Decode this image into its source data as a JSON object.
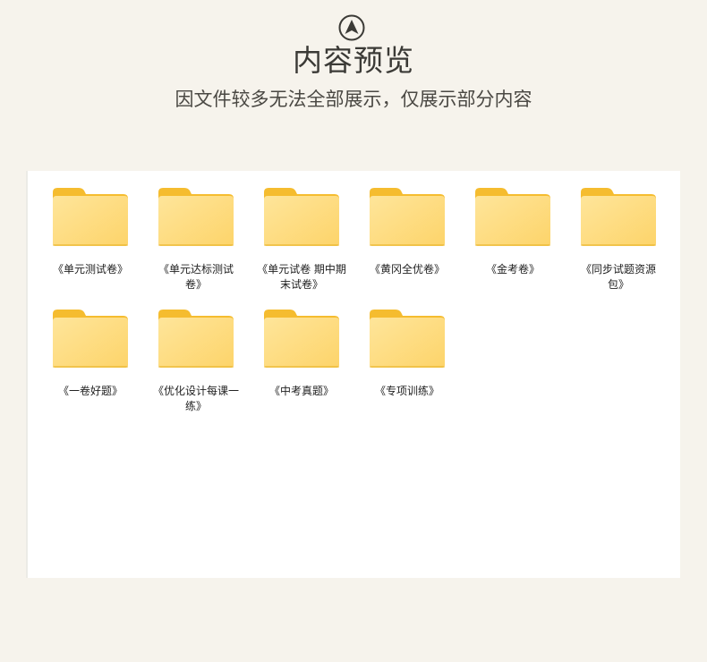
{
  "header": {
    "icon": "up-arrow-circle-icon",
    "title": "内容预览",
    "subtitle": "因文件较多无法全部展示，仅展示部分内容"
  },
  "colors": {
    "background": "#f6f3ec",
    "panel": "#ffffff",
    "folder_front": "#fdd46a",
    "folder_back": "#f5bc2f",
    "title_text": "#3b3a36"
  },
  "folders": [
    {
      "label": "《单元测试卷》",
      "icon": "folder-icon"
    },
    {
      "label": "《单元达标测试卷》",
      "icon": "folder-icon"
    },
    {
      "label": "《单元试卷 期中期末试卷》",
      "icon": "folder-icon"
    },
    {
      "label": "《黄冈全优卷》",
      "icon": "folder-icon"
    },
    {
      "label": "《金考卷》",
      "icon": "folder-icon"
    },
    {
      "label": "《同步试题资源包》",
      "icon": "folder-icon"
    },
    {
      "label": "《一卷好题》",
      "icon": "folder-icon"
    },
    {
      "label": "《优化设计每课一练》",
      "icon": "folder-icon"
    },
    {
      "label": "《中考真题》",
      "icon": "folder-icon"
    },
    {
      "label": "《专项训练》",
      "icon": "folder-icon"
    }
  ]
}
